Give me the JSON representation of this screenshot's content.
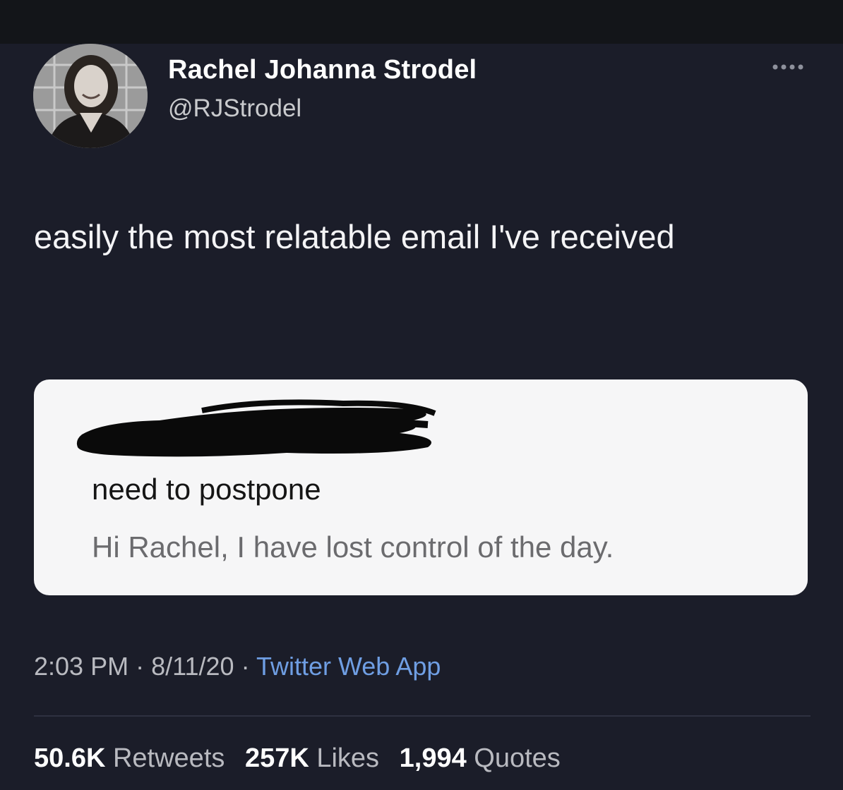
{
  "author": {
    "display_name": "Rachel Johanna Strodel",
    "handle": "@RJStrodel"
  },
  "tweet": {
    "text": "easily the most relatable email I've received"
  },
  "email": {
    "subject": "need to postpone",
    "preview": "Hi Rachel, I have lost control of the day."
  },
  "meta": {
    "time": "2:03 PM",
    "separator": "·",
    "date": "8/11/20",
    "source": "Twitter Web App"
  },
  "stats": {
    "retweets_count": "50.6K",
    "retweets_label": "Retweets",
    "likes_count": "257K",
    "likes_label": "Likes",
    "quotes_count": "1,994",
    "quotes_label": "Quotes"
  },
  "colors": {
    "background": "#1b1d29",
    "link": "#6f9ee3",
    "card": "#f6f6f7"
  },
  "icons": {
    "more": "more-icon",
    "avatar": "avatar-photo"
  }
}
